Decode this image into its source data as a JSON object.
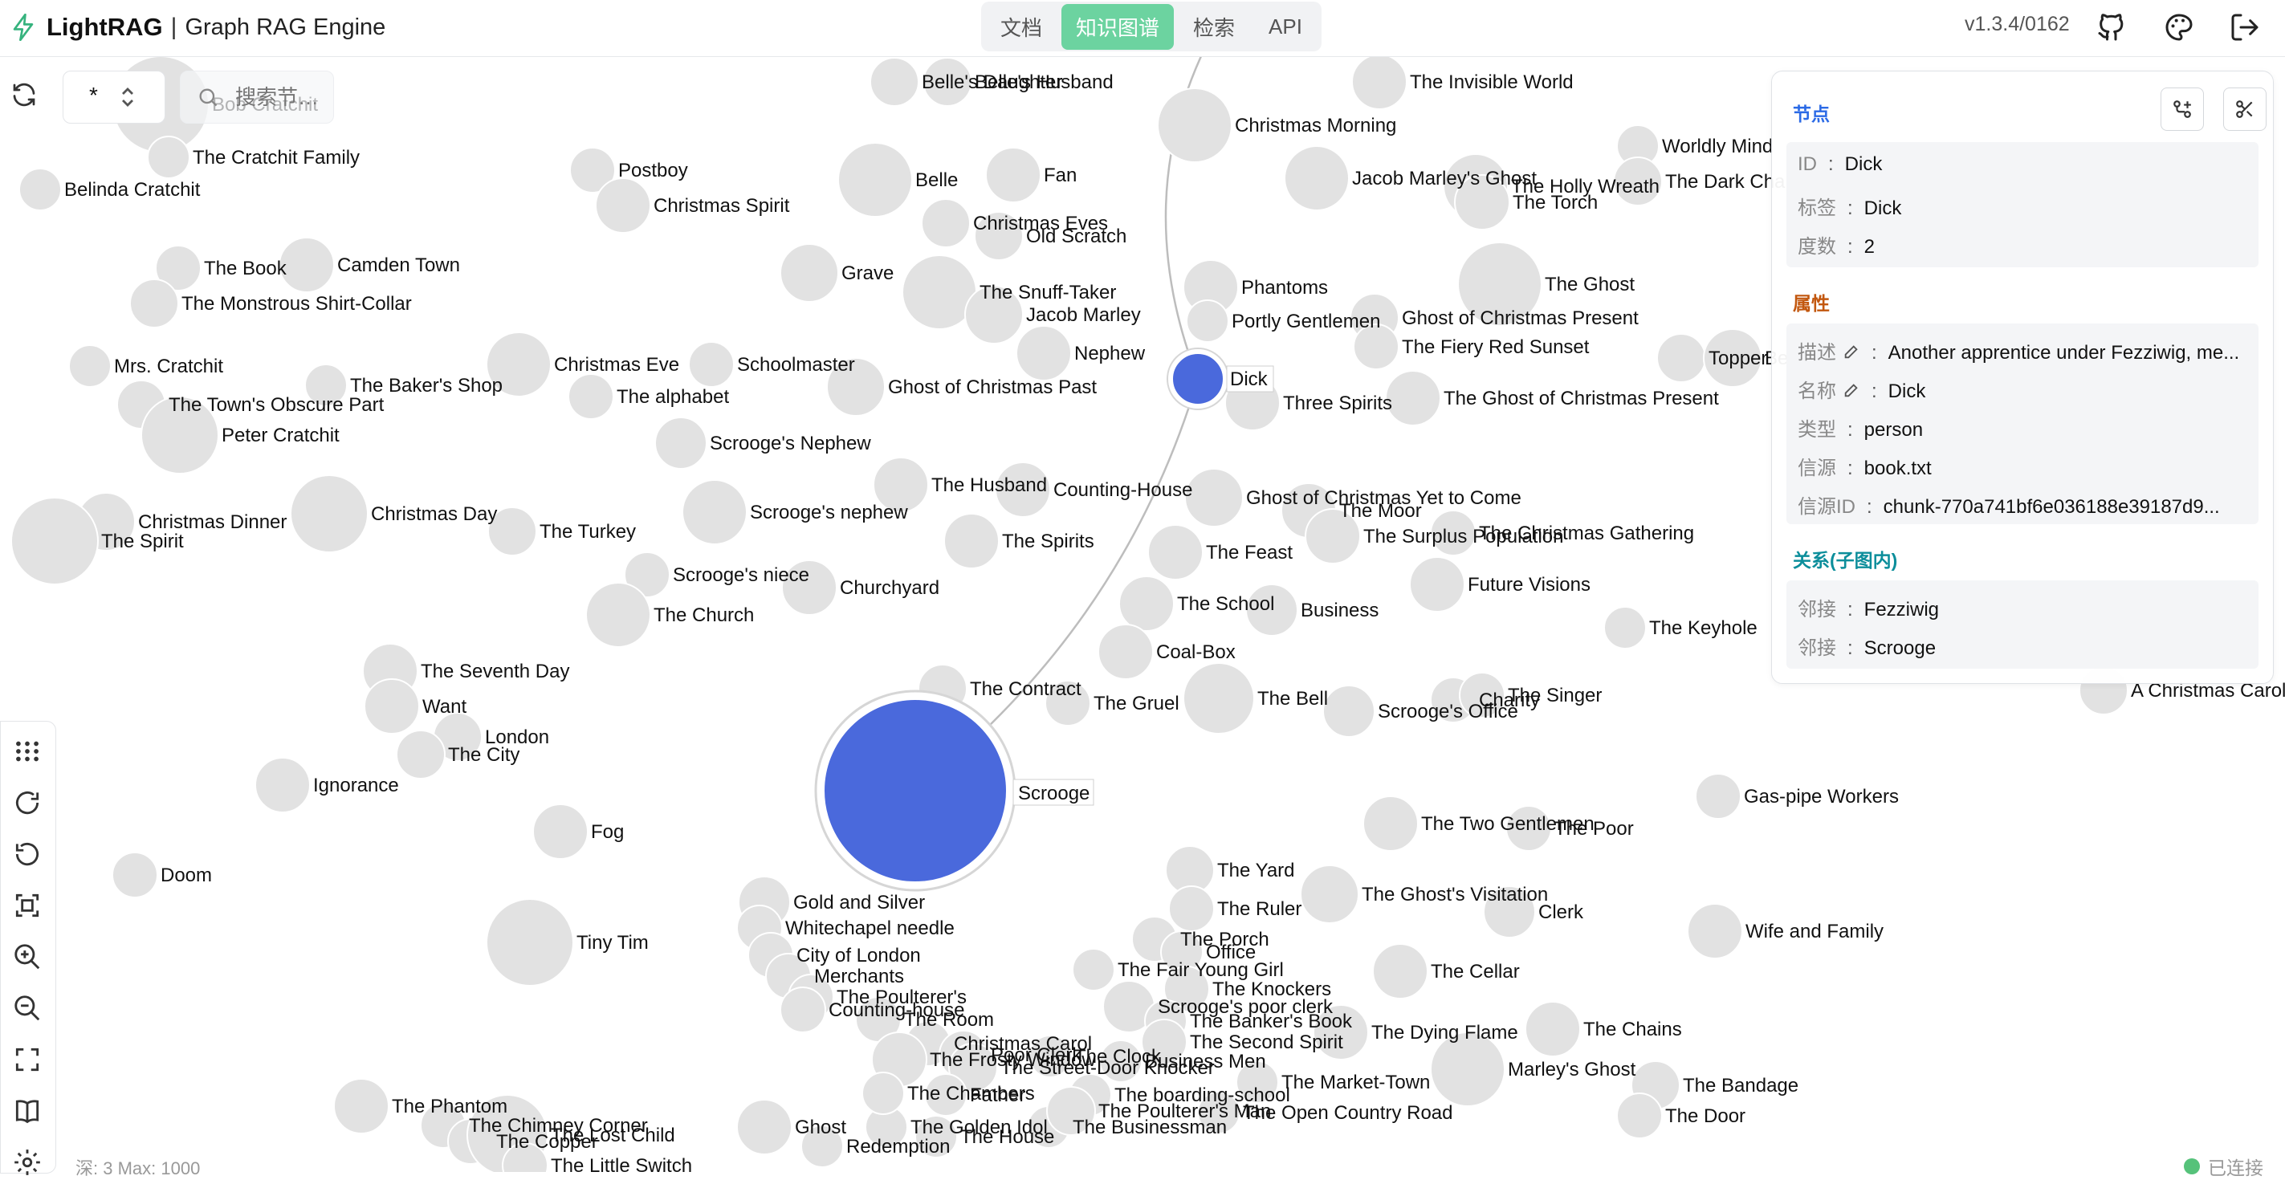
{
  "app": {
    "name": "LightRAG",
    "separator": "|",
    "subtitle": "Graph RAG Engine",
    "version": "v1.3.4/0162"
  },
  "tabs": [
    {
      "label": "文档",
      "active": false
    },
    {
      "label": "知识图谱",
      "active": true
    },
    {
      "label": "检索",
      "active": false
    },
    {
      "label": "API",
      "active": false
    }
  ],
  "header_icons": [
    "github-icon",
    "palette-icon",
    "logout-icon"
  ],
  "controls": {
    "label_select_value": "*",
    "search_placeholder": "搜索节…"
  },
  "toolbar_icons": [
    "layout-grid-icon",
    "rotate-icon",
    "undo-icon",
    "focus-icon",
    "zoom-in-icon",
    "zoom-out-icon",
    "fullscreen-icon",
    "book-icon",
    "settings-icon"
  ],
  "footer": {
    "depth_info": "深: 3   Max: 1000",
    "status": "已连接"
  },
  "colors": {
    "accent": "#6cd3a0",
    "selected_node": "#4a69dc",
    "node": "#e2e2e2",
    "status": "#56c27a"
  },
  "graph": {
    "selected_node": "Dick",
    "highlighted": [
      "Scrooge",
      "Dick"
    ],
    "node_labels": [
      "Belle's Daughter",
      "Belle's Husband",
      "Bob Cratchit",
      "The Cratchit Family",
      "Belinda Cratchit",
      "Postboy",
      "Christmas Spirit",
      "Belle",
      "Fan",
      "Christmas Eves",
      "Old Scratch",
      "The Book",
      "Camden Town",
      "Grave",
      "The Snuff-Taker",
      "Jacob Marley",
      "The Monstrous Shirt-Collar",
      "Nephew",
      "Mrs. Cratchit",
      "The Town's Obscure Part",
      "Christmas Eve",
      "Schoolmaster",
      "The Baker's Shop",
      "The alphabet",
      "Ghost of Christmas Past",
      "Peter Cratchit",
      "Scrooge's Nephew",
      "Christmas Dinner",
      "Christmas Day",
      "The Turkey",
      "Scrooge's nephew",
      "The Husband",
      "Counting-House",
      "The Spirit",
      "The Spirits",
      "Scrooge's niece",
      "Churchyard",
      "The Church",
      "The Seventh Day",
      "Want",
      "London",
      "The City",
      "Ignorance",
      "Fog",
      "Doom",
      "Tiny Tim",
      "The Phantom",
      "The Chimney Corner",
      "The Copper",
      "Ghost",
      "Redemption",
      "The Golden Idol",
      "The Businessman",
      "The House",
      "Christmas Morning",
      "The Invisible World",
      "Jacob Marley's Ghost",
      "The Holly Wreath",
      "The Torch",
      "Phantoms",
      "Portly Gentlemen",
      "Ghost of Christmas Present",
      "The Ghost",
      "The Fiery Red Sunset",
      "Topper",
      "Belle's Home",
      "The Ghost of Christmas Present",
      "Three Spirits",
      "Ghost of Christmas Yet to Come",
      "The Moor",
      "The Surplus Population",
      "The Christmas Gathering",
      "The Feast",
      "The School",
      "Business",
      "Future Visions",
      "The Keyhole",
      "Coal-Box",
      "The Contract",
      "The Gruel",
      "The Bell",
      "Scrooge's Office",
      "Charity",
      "The Singer",
      "The Two Gentlemen",
      "The Poor",
      "Gas-pipe Workers",
      "The Yard",
      "The Ghost's Visitation",
      "Clerk",
      "The Ruler",
      "Wife and Family",
      "The Porch",
      "Office",
      "The Fair Young Girl",
      "The Knockers",
      "The Cellar",
      "Scrooge's poor clerk",
      "The Banker's Book",
      "The Second Spirit",
      "The Dying Flame",
      "The Chains",
      "Marley's Ghost",
      "Business Men",
      "The boarding-school",
      "The Market-Town",
      "The Bandage",
      "The Poulterer's Man",
      "The Open Country Road",
      "The Door",
      "Gold and Silver",
      "Whitechapel needle",
      "City of London",
      "Merchants",
      "The Poulterer's",
      "Counting-house",
      "The Room",
      "Christmas Carol",
      "The Frosty Window",
      "Poor Clerk",
      "The Street-Door Knocker",
      "The Clock",
      "The Chambers",
      "Father",
      "Worldly Mind",
      "The Dark Chamber",
      "A Christmas Carol",
      "The Lost Child",
      "The Little Switch"
    ],
    "selected_label": "Dick",
    "large_label": "Scrooge"
  },
  "panel": {
    "node_title": "节点",
    "rows": [
      {
        "key": "ID",
        "value": "Dick"
      },
      {
        "key": "标签",
        "value": "Dick"
      },
      {
        "key": "度数",
        "value": "2"
      }
    ],
    "props_title": "属性",
    "props": [
      {
        "key": "描述",
        "value": "Another apprentice under Fezziwig, me...",
        "editable": true
      },
      {
        "key": "名称",
        "value": "Dick",
        "editable": true
      },
      {
        "key": "类型",
        "value": "person",
        "editable": false
      },
      {
        "key": "信源",
        "value": "book.txt",
        "editable": false
      },
      {
        "key": "信源ID",
        "value": "chunk-770a741bf6e036188e39187d9...",
        "editable": false
      }
    ],
    "rel_title": "关系(子图内)",
    "relations": [
      {
        "key": "邻接",
        "value": "Fezziwig"
      },
      {
        "key": "邻接",
        "value": "Scrooge"
      }
    ]
  }
}
